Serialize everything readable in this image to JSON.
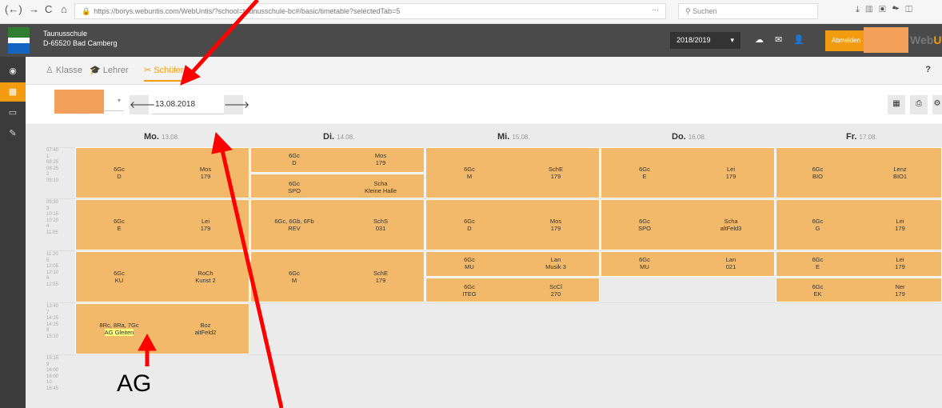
{
  "browser": {
    "back": "(←)",
    "forward": "→",
    "reload": "C",
    "home": "⌂",
    "url": "https://borys.webuntis.com/WebUntis/?school=taunusschule-bc#/basic/timetable?selectedTab=5",
    "dots": "···",
    "search_placeholder": "Suchen"
  },
  "app": {
    "school_name": "Taunusschule",
    "school_address": "D-65520 Bad Camberg",
    "year": "2018/2019",
    "logout": "Abmelden",
    "brand_a": "Web",
    "brand_b": "Un"
  },
  "tabs": [
    {
      "label": "Klasse",
      "icon": "users-icon"
    },
    {
      "label": "Lehrer",
      "icon": "graduation-cap-icon"
    },
    {
      "label": "Schüler",
      "icon": "student-icon"
    }
  ],
  "help": "?",
  "toolbar": {
    "date": "13.08.2018"
  },
  "days": [
    {
      "name": "Mo.",
      "date": "13.08."
    },
    {
      "name": "Di.",
      "date": "14.08."
    },
    {
      "name": "Mi.",
      "date": "15.08."
    },
    {
      "name": "Do.",
      "date": "16.08."
    },
    {
      "name": "Fr.",
      "date": "17.08."
    }
  ],
  "periods": [
    {
      "start": "07:40",
      "num": "1",
      "end": "08:25"
    },
    {
      "start": "08:25",
      "num": "2",
      "end": "09:10"
    },
    {
      "start": "09:30",
      "num": "3",
      "end": "10:15"
    },
    {
      "start": "10:20",
      "num": "4",
      "end": "11:05"
    },
    {
      "start": "11:20",
      "num": "5",
      "end": "12:05"
    },
    {
      "start": "12:10",
      "num": "6",
      "end": "12:55"
    },
    {
      "start": "13:40",
      "num": "7",
      "end": "14:25"
    },
    {
      "start": "14:25",
      "num": "8",
      "end": "15:10"
    },
    {
      "start": "15:15",
      "num": "9",
      "end": "16:00"
    },
    {
      "start": "16:00",
      "num": "10",
      "end": "16:45"
    }
  ],
  "lessons": {
    "mo1": {
      "cls": "6Gc",
      "subj": "D",
      "tch": "Mos",
      "room": "179"
    },
    "mo2": {
      "cls": "6Gc",
      "subj": "E",
      "tch": "Lei",
      "room": "179"
    },
    "mo3": {
      "cls": "6Gc",
      "subj": "KU",
      "tch": "RoCh",
      "room": "Kunst 2"
    },
    "mo4": {
      "cls": "8Rc, 8Ra, 7Gc",
      "subj": "AG Gleiten",
      "tch": "Boz",
      "room": "altFeld2"
    },
    "di1": {
      "cls": "6Gc",
      "subj": "D",
      "tch": "Mos",
      "room": "179"
    },
    "di2": {
      "cls": "6Gc",
      "subj": "SPO",
      "tch": "Scha",
      "room": "Kleine Halle"
    },
    "di3": {
      "cls": "6Gc, 6Gb, 6Fb",
      "subj": "REV",
      "tch": "SchS",
      "room": "031"
    },
    "di4": {
      "cls": "6Gc",
      "subj": "M",
      "tch": "SchE",
      "room": "179"
    },
    "mi1": {
      "cls": "6Gc",
      "subj": "M",
      "tch": "SchE",
      "room": "179"
    },
    "mi2": {
      "cls": "6Gc",
      "subj": "D",
      "tch": "Mos",
      "room": "179"
    },
    "mi3": {
      "cls": "6Gc",
      "subj": "MU",
      "tch": "Lan",
      "room": "Musik 3"
    },
    "mi4": {
      "cls": "6Gc",
      "subj": "ITEG",
      "tch": "ScCl",
      "room": "270"
    },
    "do1": {
      "cls": "6Gc",
      "subj": "E",
      "tch": "Lei",
      "room": "179"
    },
    "do2": {
      "cls": "6Gc",
      "subj": "SPO",
      "tch": "Scha",
      "room": "altFeld3"
    },
    "do3": {
      "cls": "6Gc",
      "subj": "MU",
      "tch": "Lan",
      "room": "021"
    },
    "fr1": {
      "cls": "6Gc",
      "subj": "BIO",
      "tch": "Lenz",
      "room": "BIO1"
    },
    "fr2": {
      "cls": "6Gc",
      "subj": "G",
      "tch": "Lei",
      "room": "179"
    },
    "fr3": {
      "cls": "6Gc",
      "subj": "E",
      "tch": "Lei",
      "room": "179"
    },
    "fr4": {
      "cls": "6Gc",
      "subj": "EK",
      "tch": "Ner",
      "room": "179"
    }
  },
  "annotation": {
    "label": "AG"
  },
  "colors": {
    "accent": "#f39c12",
    "lesson": "#f2b96a",
    "arrow": "#ff0000",
    "highlight": "#ffff7a"
  }
}
